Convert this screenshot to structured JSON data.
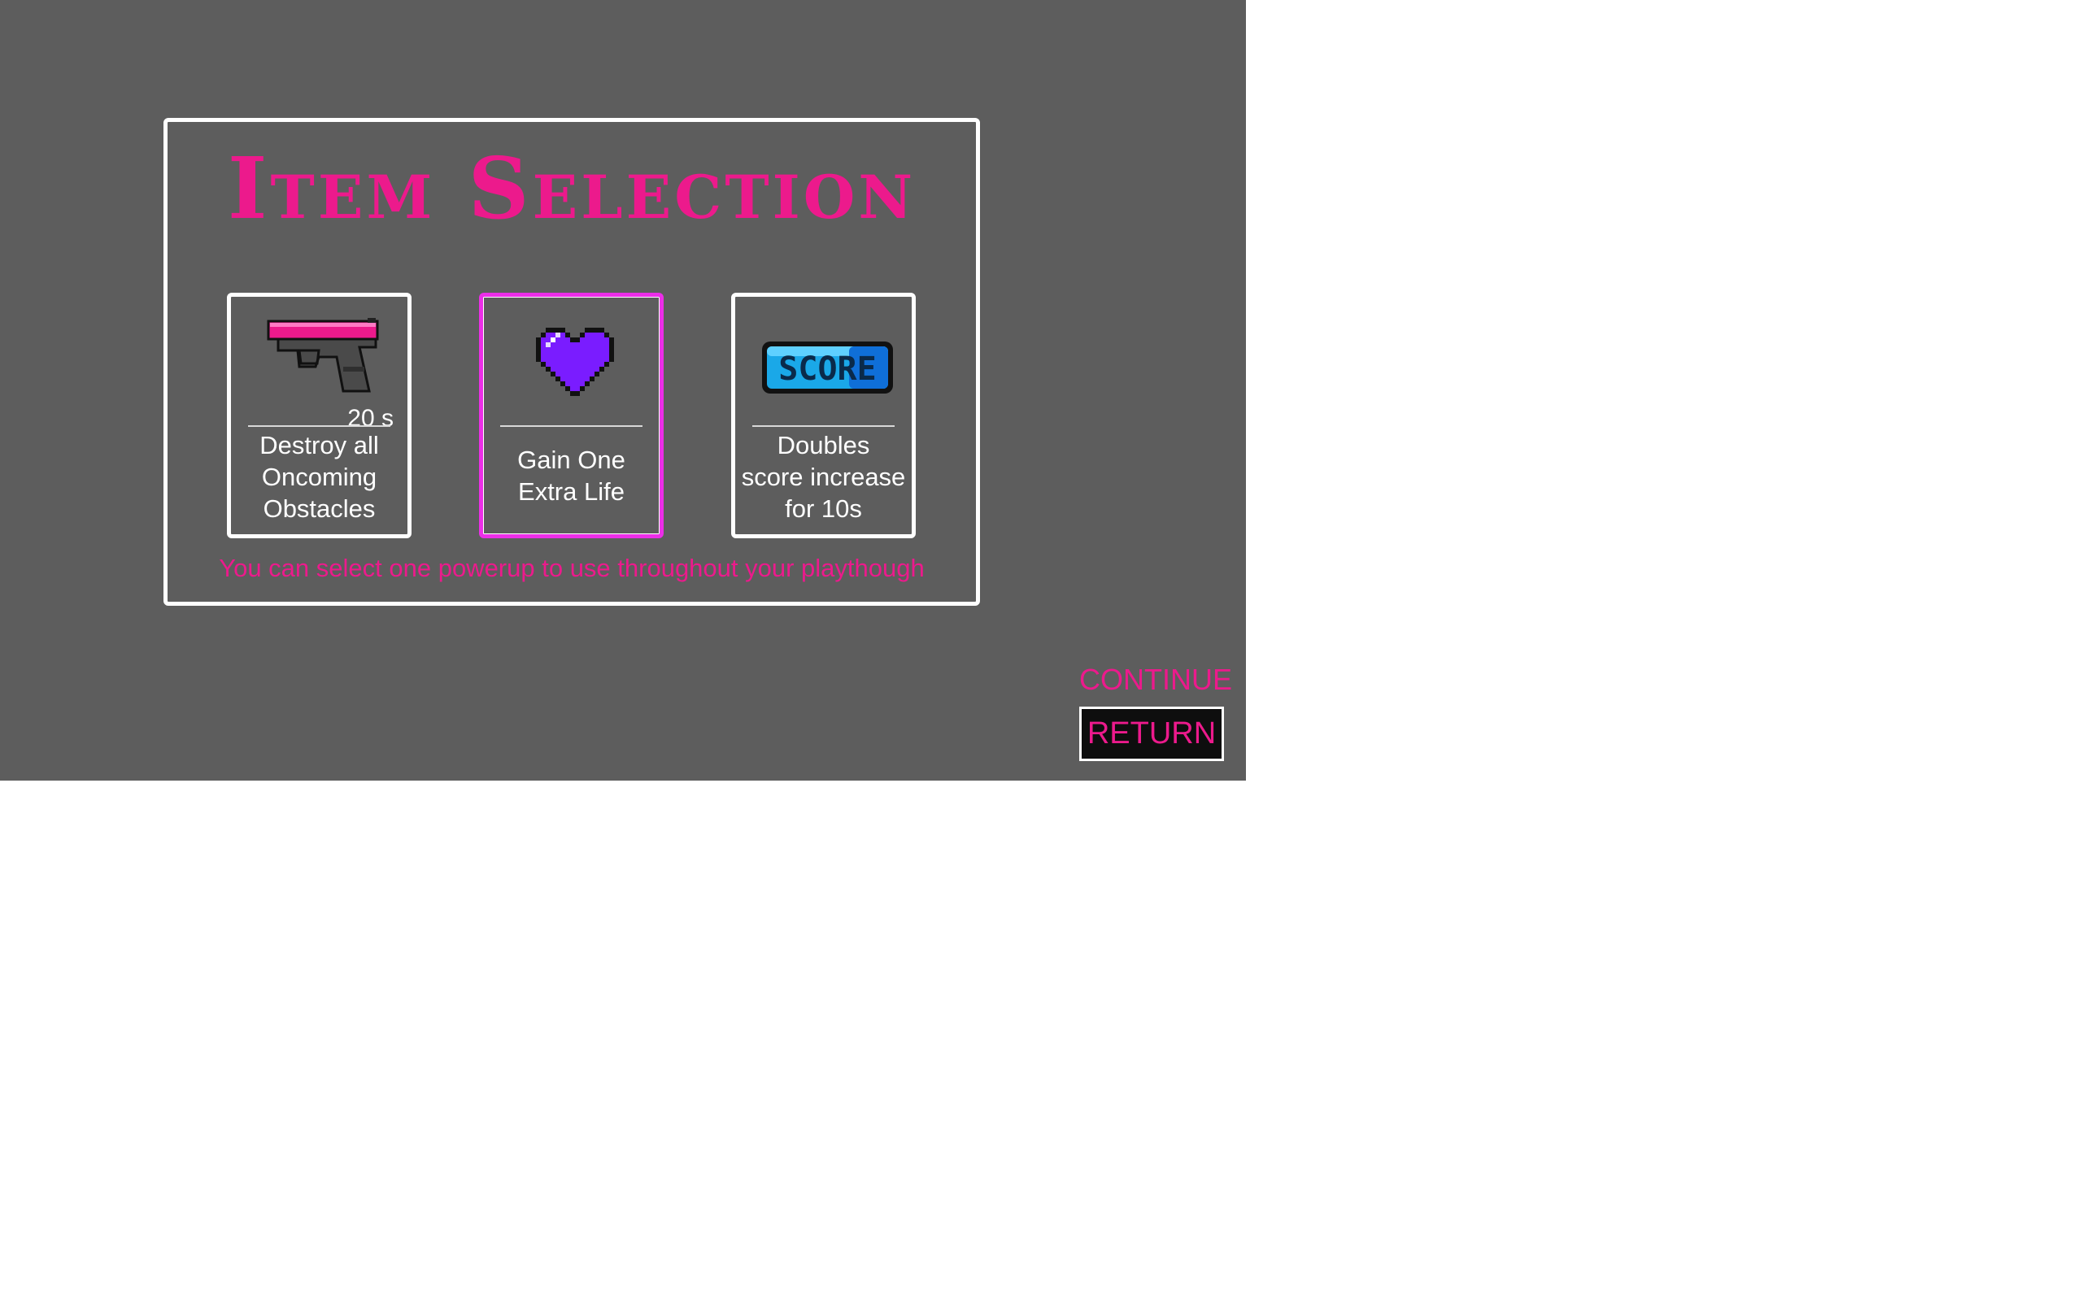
{
  "title": "Item Selection",
  "items": [
    {
      "icon": "pistol-icon",
      "duration": "20 s",
      "description_lines": [
        "Destroy all",
        "Oncoming",
        "Obstacles"
      ],
      "selected": false
    },
    {
      "icon": "heart-icon",
      "duration": "",
      "description_lines": [
        "Gain One",
        "Extra Life"
      ],
      "selected": true
    },
    {
      "icon": "score-icon",
      "icon_text": "SCORE",
      "duration": "",
      "description_lines": [
        "Doubles",
        "score increase",
        "for 10s"
      ],
      "selected": false
    }
  ],
  "footnote": "You can select one powerup to use throughout your playthough",
  "buttons": {
    "continue": "CONTINUE",
    "return": "RETURN"
  },
  "colors": {
    "background": "#5d5d5d",
    "accent": "#ec1a8c",
    "selected_border": "#ec2ee8",
    "heart": "#7a1cff",
    "score_badge": "#1aa8e8",
    "button_bg": "#0e0e0e"
  }
}
